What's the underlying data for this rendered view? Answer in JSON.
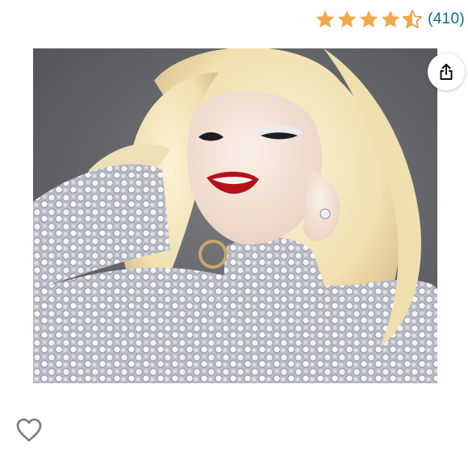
{
  "rating": {
    "value": 4.5,
    "max": 5,
    "count_text": "(410)",
    "star_color": "#f3a847",
    "count_color": "#007185"
  },
  "product_image": {
    "subject": "woman-with-platinum-blonde-hair-in-crystal-embellished-outfit",
    "background_color": "#5f6164"
  },
  "actions": {
    "share_icon": "share-icon",
    "wishlist_icon": "heart-outline-icon"
  }
}
